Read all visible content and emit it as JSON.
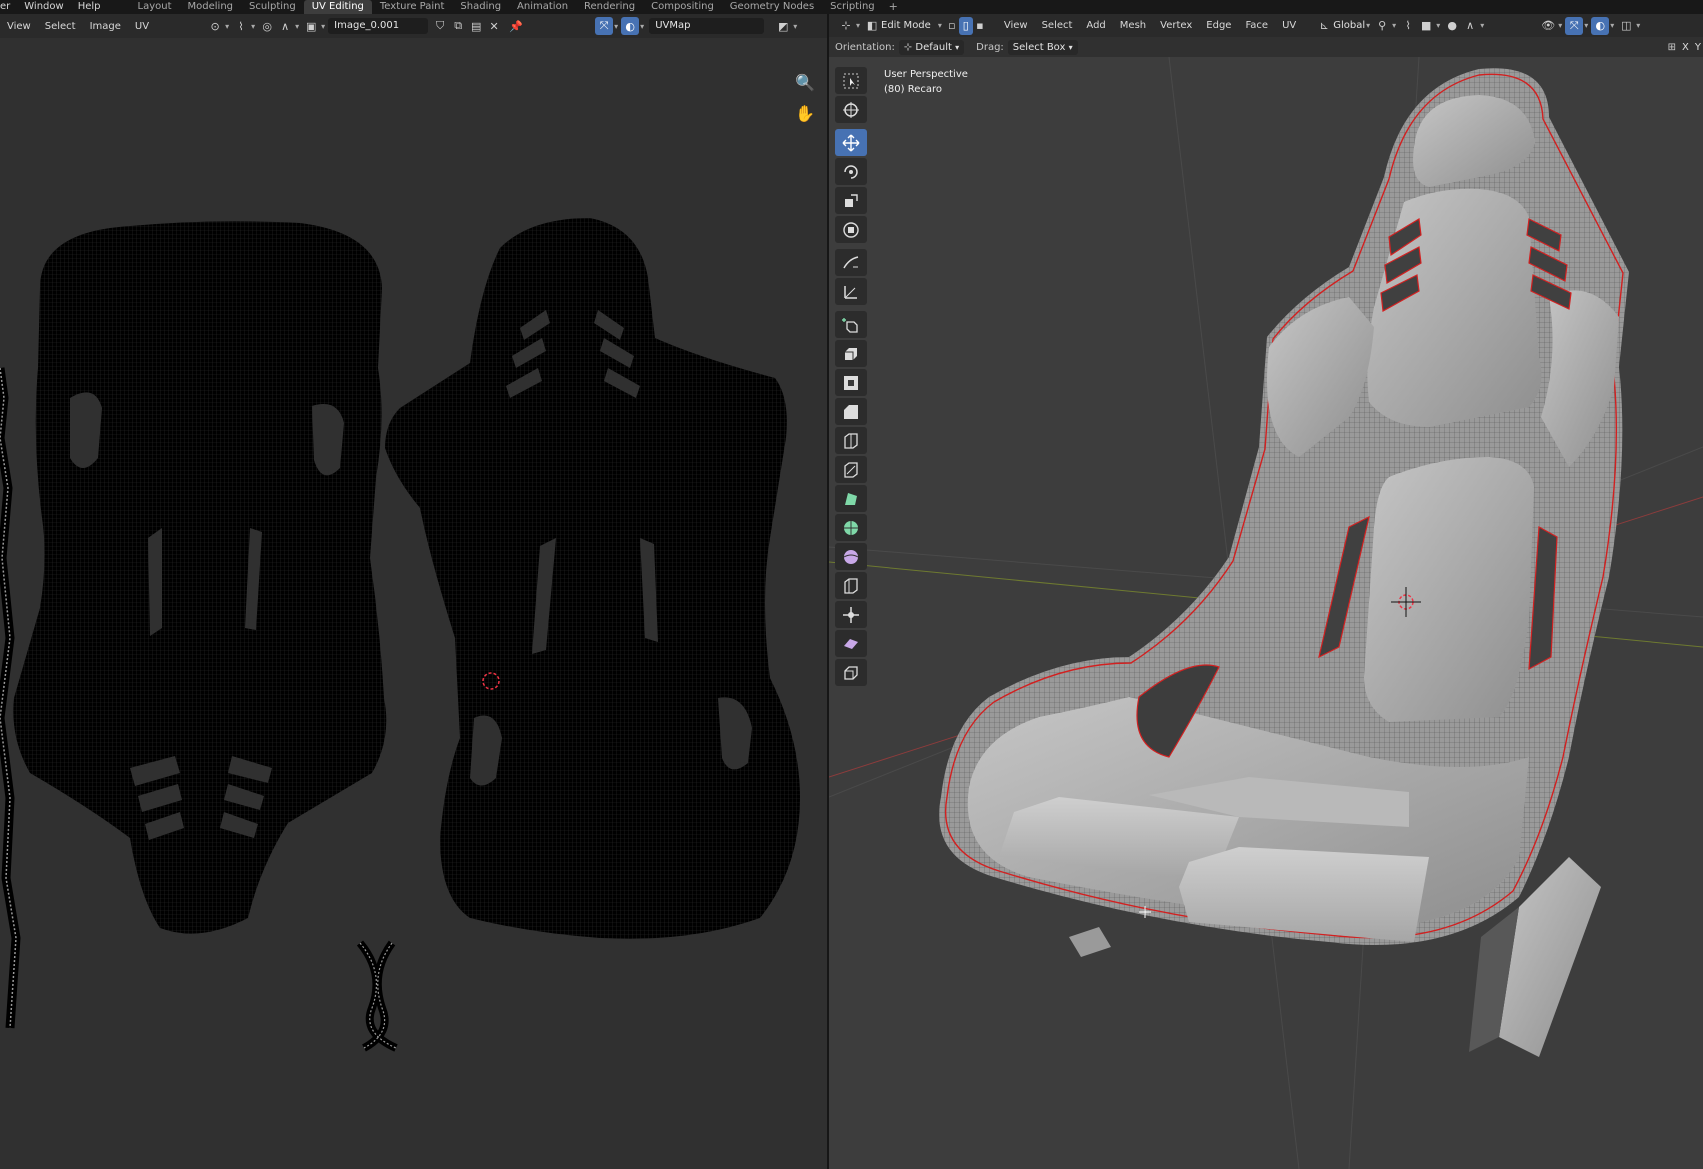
{
  "topbar": {
    "menus": [
      "er",
      "Window",
      "Help"
    ],
    "workspaces": [
      "Layout",
      "Modeling",
      "Sculpting",
      "UV Editing",
      "Texture Paint",
      "Shading",
      "Animation",
      "Rendering",
      "Compositing",
      "Geometry Nodes",
      "Scripting"
    ],
    "active_workspace": "UV Editing",
    "add_tab": "+"
  },
  "uv_editor": {
    "menus": [
      "View",
      "Select",
      "Image",
      "UV"
    ],
    "image_name": "Image_0.001",
    "uv_map": "UVMap",
    "background": "#303030"
  },
  "viewport": {
    "mode": "Edit Mode",
    "menus": [
      "View",
      "Select",
      "Add",
      "Mesh",
      "Vertex",
      "Edge",
      "Face",
      "UV"
    ],
    "transform_orientation": "Global",
    "orientation_label": "Orientation:",
    "orientation_value": "Default",
    "drag_label": "Drag:",
    "drag_value": "Select Box",
    "overlay_line1": "User Perspective",
    "overlay_line2": "(80) Recaro",
    "axis_x": "X",
    "axis_y": "Y",
    "background": "#3d3d3d"
  },
  "toolbar": {
    "tools": [
      "select-box",
      "cursor",
      "move",
      "rotate",
      "scale",
      "transform",
      "annotate",
      "measure",
      "add-cube",
      "extrude",
      "inset",
      "bevel",
      "loop-cut",
      "knife",
      "poly-build",
      "spin",
      "smooth",
      "edge-slide",
      "shrink-fatten",
      "shear",
      "rip-region"
    ],
    "active_tool": "move"
  },
  "colors": {
    "accent": "#4772b3",
    "seam": "#d22020",
    "seat_gray": "#b4b4b4"
  }
}
